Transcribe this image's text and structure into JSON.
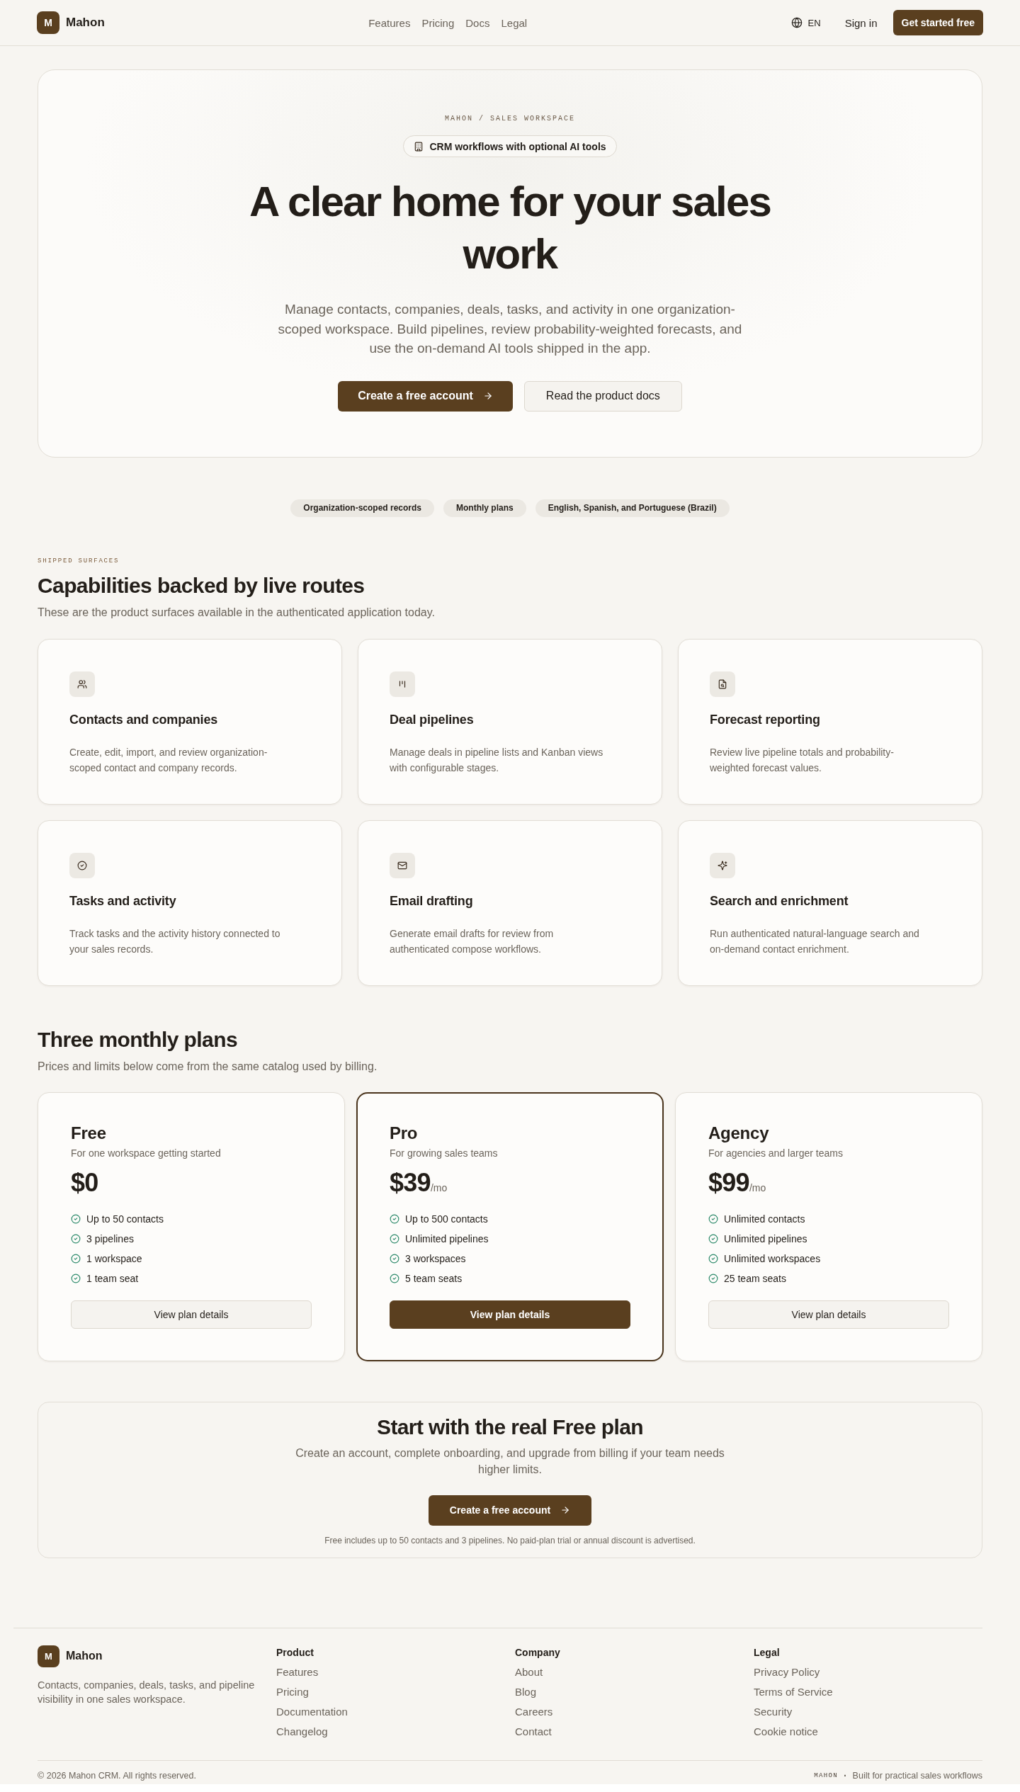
{
  "nav": {
    "brand_mark": "M",
    "brand": "Mahon",
    "links": [
      "Features",
      "Pricing",
      "Docs",
      "Legal"
    ],
    "language": "EN",
    "sign_in": "Sign in",
    "cta": "Get started free"
  },
  "hero": {
    "eyebrow": "MAHON / SALES WORKSPACE",
    "badge": "CRM workflows with optional AI tools",
    "title": "A clear home for your sales work",
    "subtitle": "Manage contacts, companies, deals, tasks, and activity in one organization-scoped workspace. Build pipelines, review probability-weighted forecasts, and use the on-demand AI tools shipped in the app.",
    "primary_button": "Create a free account",
    "secondary_button": "Read the product docs"
  },
  "highlights": [
    "Organization-scoped records",
    "Monthly plans",
    "English, Spanish, and Portuguese (Brazil)"
  ],
  "capabilities": {
    "eyebrow": "SHIPPED SURFACES",
    "title": "Capabilities backed by live routes",
    "subtitle": "These are the product surfaces available in the authenticated application today.",
    "cards": [
      {
        "kind": "contacts",
        "title": "Contacts and companies",
        "description": "Create, edit, import, and review organization-scoped contact and company records."
      },
      {
        "kind": "pipelines",
        "title": "Deal pipelines",
        "description": "Manage deals in pipeline lists and Kanban views with configurable stages."
      },
      {
        "kind": "forecast",
        "title": "Forecast reporting",
        "description": "Review live pipeline totals and probability-weighted forecast values."
      },
      {
        "kind": "tasks",
        "title": "Tasks and activity",
        "description": "Track tasks and the activity history connected to your sales records."
      },
      {
        "kind": "email",
        "title": "Email drafting",
        "description": "Generate email drafts for review from authenticated compose workflows."
      },
      {
        "kind": "search",
        "title": "Search and enrichment",
        "description": "Run authenticated natural-language search and on-demand contact enrichment."
      }
    ]
  },
  "pricing": {
    "title": "Three monthly plans",
    "subtitle": "Prices and limits below come from the same catalog used by billing.",
    "plans": [
      {
        "name": "Free",
        "tagline": "For one workspace getting started",
        "price": "$0",
        "featured": false,
        "features": [
          "Up to 50 contacts",
          "3 pipelines",
          "1 workspace",
          "1 team seat"
        ],
        "button": "View plan details"
      },
      {
        "name": "Pro",
        "tagline": "For growing sales teams",
        "price": "$39",
        "period": "/mo",
        "featured": true,
        "features": [
          "Up to 500 contacts",
          "Unlimited pipelines",
          "3 workspaces",
          "5 team seats"
        ],
        "button": "View plan details"
      },
      {
        "name": "Agency",
        "tagline": "For agencies and larger teams",
        "price": "$99",
        "period": "/mo",
        "featured": false,
        "features": [
          "Unlimited contacts",
          "Unlimited pipelines",
          "Unlimited workspaces",
          "25 team seats"
        ],
        "button": "View plan details"
      }
    ]
  },
  "cta": {
    "title": "Start with the real Free plan",
    "text": "Create an account, complete onboarding, and upgrade from billing if your team needs higher limits.",
    "button": "Create a free account",
    "note": "Free includes up to 50 contacts and 3 pipelines. No paid-plan trial or annual discount is advertised."
  },
  "footer": {
    "brand_mark": "M",
    "brand": "Mahon",
    "description": "Contacts, companies, deals, tasks, and pipeline visibility in one sales workspace.",
    "columns": [
      {
        "title": "Product",
        "links": [
          "Features",
          "Pricing",
          "Documentation",
          "Changelog"
        ]
      },
      {
        "title": "Company",
        "links": [
          "About",
          "Blog",
          "Careers",
          "Contact"
        ]
      },
      {
        "title": "Legal",
        "links": [
          "Privacy Policy",
          "Terms of Service",
          "Security",
          "Cookie notice"
        ]
      }
    ],
    "copyright": "© 2026 Mahon CRM. All rights reserved.",
    "tagline_mark": "MAHON",
    "separator": "·",
    "tagline": "Built for practical sales workflows"
  }
}
